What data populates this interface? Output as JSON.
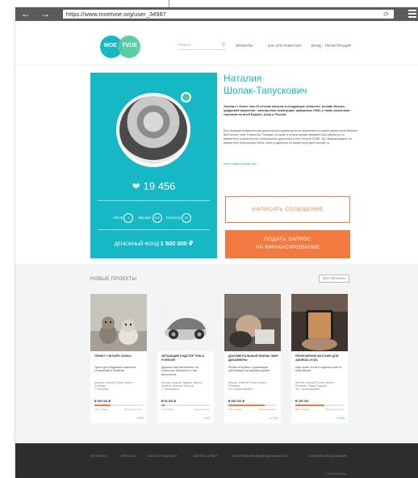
{
  "browser": {
    "url": "https://www.moetvoe.org/user_34987"
  },
  "header": {
    "logo_left": "MOE",
    "logo_right": "TVOE",
    "search_placeholder": "ПОИСК",
    "nav": [
      "ПРОЕКТЫ",
      "КАК ЭТО РАБОТАЕТ",
      "ВХОД",
      "РЕГИСТРАЦИЯ"
    ]
  },
  "profile": {
    "name_line1": "Наталия",
    "name_line2": "Шолак-Тапускович",
    "likes": "19 456",
    "roles": [
      {
        "label": "Автор",
        "count": "2"
      },
      {
        "label": "Эксперт",
        "count": "112"
      },
      {
        "label": "Спонсор",
        "count": "42"
      }
    ],
    "fund_label": "ДЕНЕЖНЫЙ ФОНД",
    "fund_value": "1 500 000 ₽",
    "bio_bold": "Эксперт с более чем 15 летним опытом в следующих областях: онлайн-бизнес, цифровой маркетинг, электронная коммерция, цифровые СМИ, а также розничная торговля по всей Европе, Азии и России.",
    "bio": "Был бывшим коммерческим директором и директором по маркетингу в совете директоров Венеры Винтчелли, сети Travelocity. Позиции, которые я успела время занимать Был директор по маркетингу в заместитель генерального директора Indoo Victoria GDBR, BU, вицепрезидент по маркетингу Корпорации Gloria Jeans и директор по маркетингу для Lamoda, ru.",
    "site": "www.natalisavalak.com",
    "btn_message": "НАПИСАТЬ СООБЩЕНИЕ",
    "btn_fund_line1": "ПОДАТЬ ЗАПРОС",
    "btn_fund_line2": "НА ФИНАНСИРОВАНИЕ"
  },
  "projects": {
    "title": "НОВЫЕ ПРОЕКТЫ",
    "all_button": "ВСЕ ПРОЕКТЫ",
    "items": [
      {
        "tag": "ПРИЮТ «ЧЕТЫРЕ ЛАПЫ»",
        "desc": "Приют для бездомных животных, основанный в Батайске.",
        "authors": "Авторы: Алексей Попов, Никита Печенкин",
        "location": "Г. Петербург",
        "sum": "₽ 650 000 ₽",
        "progress": 33,
        "foot_left": "33% собрано",
        "foot_right": "40 дней осталось",
        "likes": "894"
      },
      {
        "tag": "ЛЕТАЮЩИЙ РОДСТЕР TESLA FOREVER",
        "desc": "Двухместный автомобиль на солнечных батареях и с пар-вертолетом",
        "authors": "Авторы: Алексей Худяков, Кирилл Зинатов, Николай Тихиров",
        "location": "Г. Новосибирск",
        "sum": "₽ 90 000 ₽",
        "progress": 7,
        "foot_left": "7% собрано",
        "foot_right": "3 дня осталось",
        "likes": "227"
      },
      {
        "tag": "ДОКУМЕНТАЛЬНЫЙ ФИЛЬМ «МИР ДИЗАЙНЕРА»",
        "desc": "Фильм-интервью о дизайнерах, работающих на мировом уровне",
        "authors": "Авторы: Алексей Попов, Никита Печенкин",
        "location": "Пос. Красноармейск",
        "sum": "₽ 590 000 ₽",
        "progress": 75,
        "foot_left": "75% собрано",
        "foot_right": "36 дней осталось",
        "likes": "1736"
      },
      {
        "tag": "ПРИЛОЖЕНИЕ MATCHER ДЛЯ ANDROID И IOS",
        "desc": "Ищи приют котов и поделись ими со всем миром",
        "authors": "Авторы: Алексей Попов, Никита Печенкин, Роман Рудаков",
        "location": "Пос. Красноармейск",
        "sum": "₽ 150 000",
        "progress": 60,
        "foot_left": "60% собрано",
        "foot_right": "19 дней осталось",
        "likes": "1268"
      }
    ]
  },
  "footer": {
    "nav": [
      "КОНТАКТЫ",
      "ПРОЕКТЫ",
      "КАК ЭТО РАБОТАЕТ",
      "ВОПРОС-ОТВЕТ",
      "ПОЛИТИКА КОНФИДЕНЦИАЛЬНОСТИ",
      "УСЛОВИЯ ПОЛЬЗОВАНИЯ"
    ],
    "copyright": "© 2016 MoeTvoe"
  },
  "colors": {
    "accent": "#17b8c5",
    "secondary": "#4ec9a0",
    "cta": "#f27a40"
  }
}
